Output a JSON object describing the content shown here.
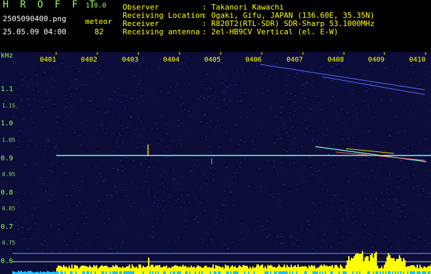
{
  "app": {
    "title": "H R O F F T",
    "version": "1.0.0",
    "filename": "2505090400.png",
    "mode": "meteor",
    "datetime": "25.05.09 04:00",
    "count": "82"
  },
  "info": {
    "rows": [
      {
        "label": "Observer",
        "value": ": Takanori Kawachi"
      },
      {
        "label": "Receiving Location",
        "value": ": Ogaki, Gifu, JAPAN (136.60E, 35.35N)"
      },
      {
        "label": "Receiver",
        "value": ": R820T2(RTL-SDR) SDR-Sharp 53.1000MHz"
      },
      {
        "label": "Receiving antenna",
        "value": ": 2el-HB9CV Vertical (el. E-W)"
      }
    ]
  },
  "axis": {
    "unit": "kHz",
    "y_ticks": [
      "1.1",
      "1.0",
      "0.9",
      "0.8",
      "0.7",
      "0.6"
    ],
    "minor_ticks": [
      "1.15",
      "1.05",
      "0.95",
      "0.85",
      "0.75",
      "0.65"
    ],
    "x_ticks": [
      "0401",
      "0402",
      "0403",
      "0404",
      "0405",
      "0406",
      "0407",
      "0408",
      "0409",
      "0410"
    ]
  },
  "colors": {
    "background": "#0d0d3a",
    "text_green": "#9aff5a",
    "text_yellow": "#ffff00",
    "carrier": "#7fffd4",
    "meteor": "#ffd700",
    "bar_fill": "#ffff00",
    "bar_blue": "#20c0ff"
  }
}
